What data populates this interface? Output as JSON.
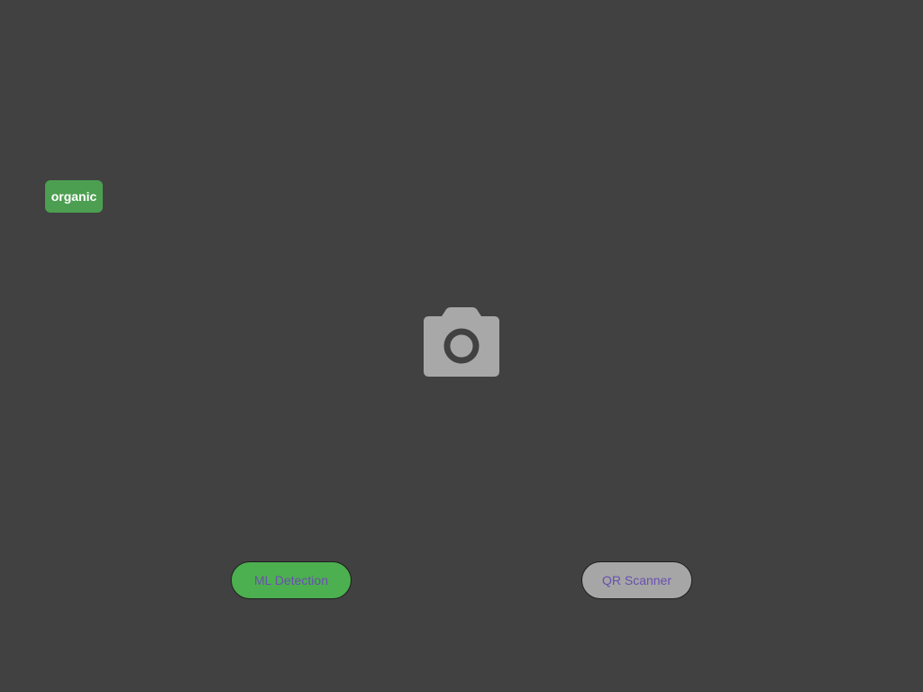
{
  "detection": {
    "label": "organic"
  },
  "camera": {
    "icon": "camera-icon",
    "color": "#a8a8a8"
  },
  "modes": {
    "ml_label": "ML Detection",
    "qr_label": "QR Scanner",
    "ml_color": "#4caf50",
    "qr_color": "#a6a6a6",
    "text_color": "#6a4fb0"
  },
  "colors": {
    "background": "#414141",
    "chip": "#4c9f50"
  }
}
